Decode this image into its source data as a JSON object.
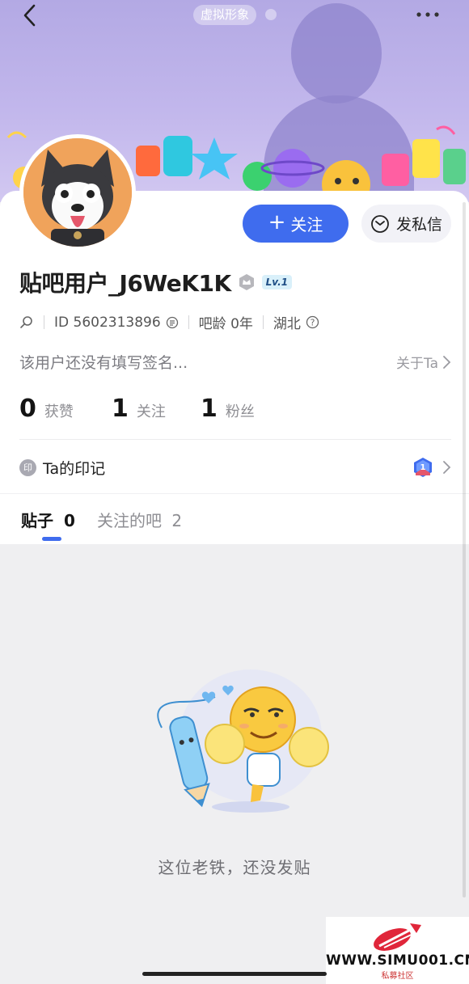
{
  "header": {
    "back_icon": "chevron-left-icon",
    "virtual_avatar_label": "虚拟形象",
    "more_icon": "more-dots-icon"
  },
  "profile": {
    "username": "贴吧用户_J6WeK1K",
    "level": "Lv.1",
    "id_label": "ID 5602313896",
    "age_label": "吧龄 0年",
    "location": "湖北",
    "signature": "该用户还没有填写签名...",
    "about_link": "关于Ta"
  },
  "actions": {
    "follow_label": "关注",
    "message_label": "发私信"
  },
  "stats": [
    {
      "value": "0",
      "label": "获赞"
    },
    {
      "value": "1",
      "label": "关注"
    },
    {
      "value": "1",
      "label": "粉丝"
    }
  ],
  "imprint": {
    "icon_text": "印",
    "label": "Ta的印记",
    "badge_number": "1"
  },
  "tabs": [
    {
      "label": "贴子",
      "count": "0"
    },
    {
      "label": "关注的吧",
      "count": "2"
    }
  ],
  "empty_state": {
    "text": "这位老铁，还没发贴"
  },
  "watermark": {
    "text": "WWW.SIMU001.CN",
    "subtext": "私募社区"
  },
  "colors": {
    "accent": "#3f6cee",
    "banner": "#b3a9e4",
    "avatar_bg": "#f0a35b"
  }
}
